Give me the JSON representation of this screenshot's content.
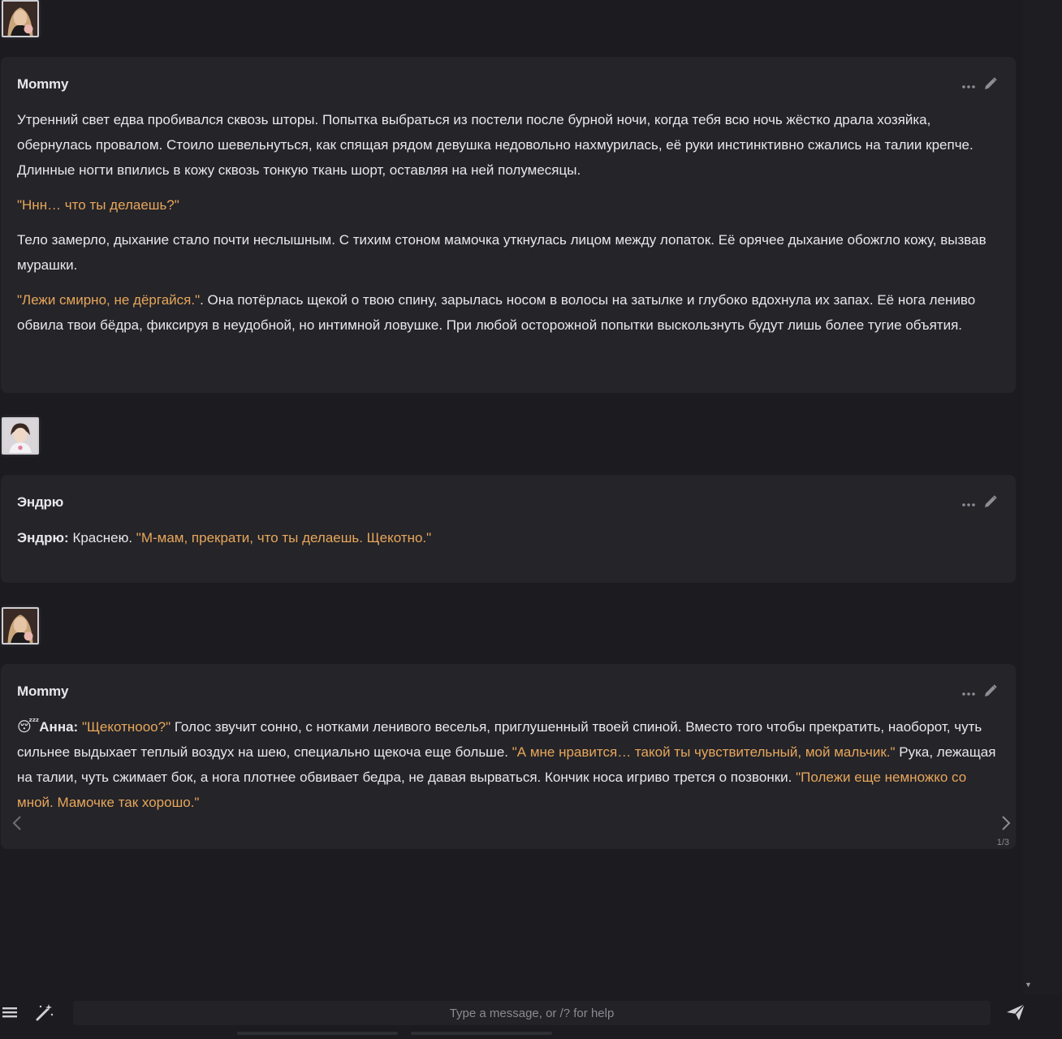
{
  "messages": [
    {
      "name": "Mommy",
      "paragraphs": [
        [
          {
            "t": "Утренний свет едва пробивался сквозь шторы. Попытка выбраться из постели после бурной ночи, когда тебя всю ночь жёстко драла хозяйка, обернулась провалом. Стоило шевельнуться, как спящая рядом девушка недовольно нахмурилась, её руки инстинктивно сжались на талии крепче. Длинные ногти впились в кожу сквозь тонкую ткань шорт, оставляя на ней полумесяцы."
          }
        ],
        [
          {
            "t": "\"Ннн… что ты делаешь?\"",
            "q": true
          }
        ],
        [
          {
            "t": "Тело замерло, дыхание стало почти неслышным. С тихим стоном мамочка уткнулась лицом между лопаток. Её орячее дыхание обожгло кожу, вызвав мурашки."
          }
        ],
        [
          {
            "t": "\"Лежи смирно, не дёргайся.\"",
            "q": true
          },
          {
            "t": ". Она потёрлась щекой о твою спину, зарылась носом в волосы на затылке и глубоко вдохнула их запах. Её нога лениво обвила твои бёдра, фиксируя в неудобной, но интимной ловушке. При любой осторожной попытки выскользнуть будут лишь более тугие объятия."
          }
        ]
      ]
    },
    {
      "name": "Эндрю",
      "paragraphs": [
        [
          {
            "t": "Эндрю:",
            "b": true
          },
          {
            "t": " Краснею. "
          },
          {
            "t": "\"М-мам, прекрати, что ты делаешь. Щекотно.\"",
            "q": true
          }
        ]
      ]
    },
    {
      "name": "Mommy",
      "paragraphs": [
        [
          {
            "t": "😴"
          },
          {
            "t": "Анна:",
            "b": true
          },
          {
            "t": " "
          },
          {
            "t": "\"Щекотнооо?\"",
            "q": true
          },
          {
            "t": " Голос звучит сонно, с нотками ленивого веселья, приглушенный твоей спиной. Вместо того чтобы прекратить, наоборот, чуть сильнее выдыхает теплый воздух на шею, специально щекоча еще больше. "
          },
          {
            "t": "\"А мне нравится… такой ты чувствительный, мой мальчик.\"",
            "q": true
          },
          {
            "t": " Рука, лежащая на талии, чуть сжимает бок, а нога плотнее обвивает бедра, не давая вырваться. Кончик носа игриво трется о позвонки. "
          },
          {
            "t": "\"Полежи еще немножко со мной. Мамочке так хорошо.\"",
            "q": true
          }
        ]
      ],
      "swipe_counter": "1/3"
    }
  ],
  "input": {
    "placeholder": "Type a message, or /? for help",
    "value": ""
  },
  "icons": {
    "menu": "hamburger-menu-icon",
    "wand": "magic-wand-icon",
    "send": "paper-plane-icon",
    "more": "ellipsis-icon",
    "edit": "pencil-icon",
    "swipe_left": "chevron-left-icon",
    "swipe_right": "chevron-right-icon"
  },
  "colors": {
    "background": "#1b1b20",
    "bubble": "#242429",
    "quote": "#e8a65a",
    "text": "#e8e8ec"
  }
}
